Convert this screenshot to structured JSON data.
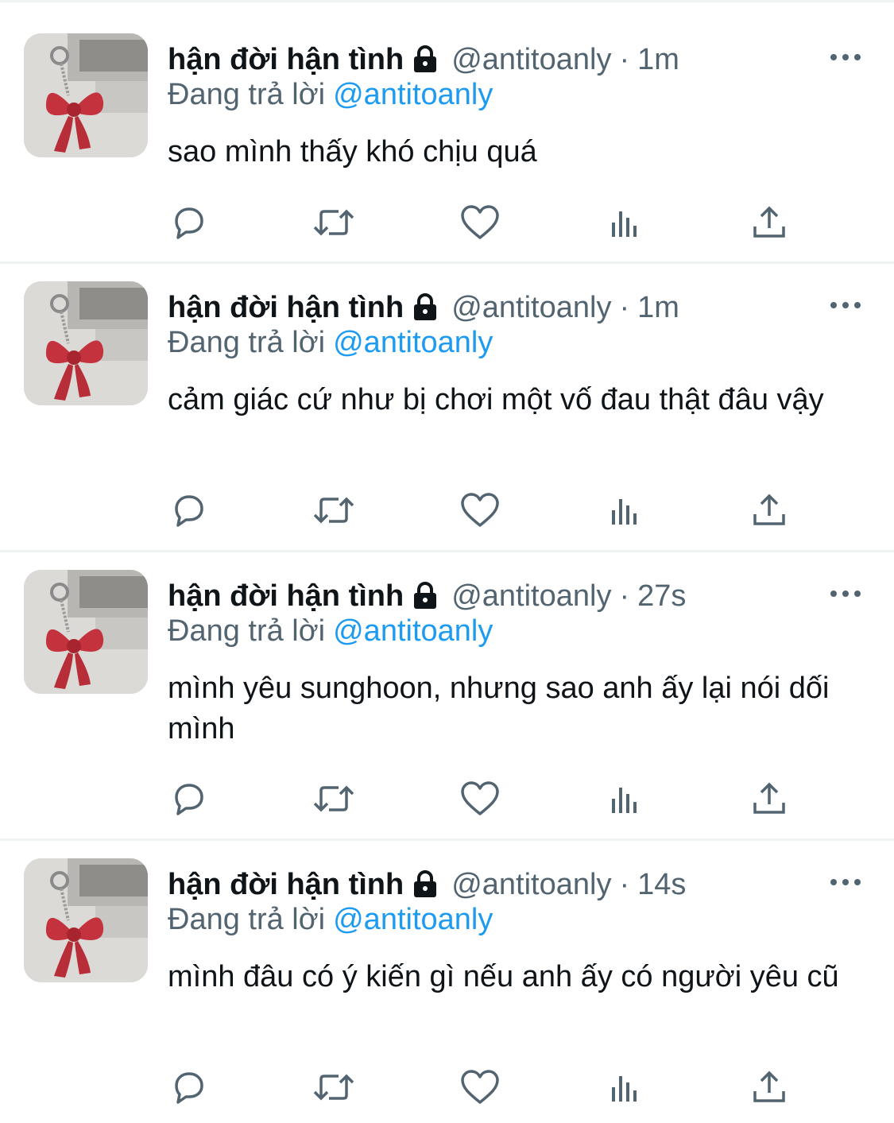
{
  "tweets": [
    {
      "name": "hận đời hận tình",
      "handle": "@antitoanly",
      "separator": "·",
      "time": "1m",
      "reply_prefix": "Đang trả lời",
      "reply_mention": "@antitoanly",
      "text": "sao mình thấy khó chịu quá"
    },
    {
      "name": "hận đời hận tình",
      "handle": "@antitoanly",
      "separator": "·",
      "time": "1m",
      "reply_prefix": "Đang trả lời",
      "reply_mention": "@antitoanly",
      "text": "cảm giác cứ như bị chơi một vố đau thật đâu vậy"
    },
    {
      "name": "hận đời hận tình",
      "handle": "@antitoanly",
      "separator": "·",
      "time": "27s",
      "reply_prefix": "Đang trả lời",
      "reply_mention": "@antitoanly",
      "text": "mình yêu sunghoon, nhưng sao anh ấy lại nói dối mình"
    },
    {
      "name": "hận đời hận tình",
      "handle": "@antitoanly",
      "separator": "·",
      "time": "14s",
      "reply_prefix": "Đang trả lời",
      "reply_mention": "@antitoanly",
      "text": "mình đâu có ý kiến gì nếu anh ấy có người yêu cũ"
    }
  ],
  "icons": {
    "lock": "lock-icon",
    "more": "more-icon",
    "reply": "reply-icon",
    "retweet": "retweet-icon",
    "like": "heart-icon",
    "views": "views-icon",
    "share": "share-icon"
  },
  "colors": {
    "text": "#0f1419",
    "secondary": "#536471",
    "mention": "#1d9bf0",
    "divider": "#eff3f4"
  }
}
